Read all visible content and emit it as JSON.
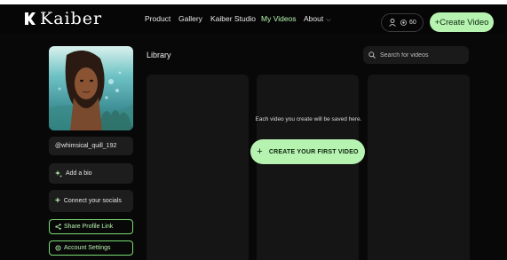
{
  "brand": {
    "logo_text": "Kaiber"
  },
  "nav": {
    "links": [
      {
        "label": "Product",
        "active": false
      },
      {
        "label": "Gallery",
        "active": false
      },
      {
        "label": "Kaiber Studio",
        "active": false
      },
      {
        "label": "My Videos",
        "active": true
      },
      {
        "label": "About",
        "active": false,
        "has_dropdown": true
      }
    ],
    "credits": "60",
    "create_label": "+Create Video"
  },
  "profile": {
    "username": "@whimsical_quill_192",
    "add_bio": "Add a bio",
    "connect_socials": "Connect your socials",
    "share_link": "Share Profile Link",
    "account_settings": "Account Settings"
  },
  "library": {
    "title": "Library",
    "search_placeholder": "Search for videos",
    "empty_message": "Each video you create will be saved here.",
    "create_first_label": "CREATE YOUR FIRST VIDEO"
  },
  "colors": {
    "accent": "#b6f2b0",
    "background": "#080808",
    "panel": "#1d1d1d"
  },
  "icons": [
    "kaiber-logo-icon",
    "user-icon",
    "credits-icon",
    "chevron-down-icon",
    "search-icon",
    "sparkle-icon",
    "plus-icon",
    "share-icon",
    "settings-icon"
  ]
}
